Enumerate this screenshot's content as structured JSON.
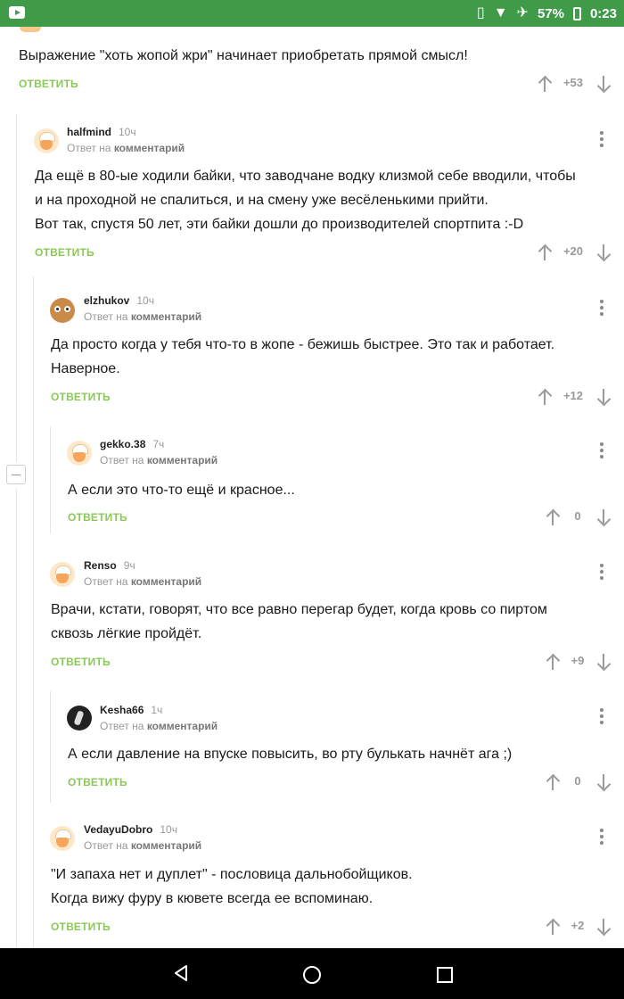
{
  "status_bar": {
    "app_icon": "youtube-icon",
    "icons": [
      "vibrate-icon",
      "wifi-icon",
      "airplane-icon"
    ],
    "battery": "57%",
    "time": "0:23"
  },
  "labels": {
    "reply_button": "ОТВЕТИТЬ",
    "reply_to_prefix": "Ответ на",
    "reply_to_target": "комментарий"
  },
  "top_comment": {
    "text": "Выражение \"хоть жопой жри\" начинает приобретать прямой смысл!",
    "score": "+53"
  },
  "comments": [
    {
      "author": "halfmind",
      "time": "10ч",
      "avatar": "cook",
      "lines": [
        "Да ещё в 80-ые ходили байки, что заводчане водку клизмой себе вводили, чтобы",
        "и на проходной не спалиться, и на смену уже весёленькими прийти.",
        "Вот так, спустя 50 лет, эти байки дошли до производителей спортпита :-D"
      ],
      "score": "+20"
    },
    {
      "author": "elzhukov",
      "time": "10ч",
      "avatar": "owl",
      "lines": [
        "Да просто когда у тебя что-то в жопе - бежишь быстрее. Это так и работает.",
        "Наверное."
      ],
      "score": "+12"
    },
    {
      "author": "gekko.38",
      "time": "7ч",
      "avatar": "cook",
      "lines": [
        "А если это что-то ещё и красное..."
      ],
      "score": "0"
    },
    {
      "author": "Renso",
      "time": "9ч",
      "avatar": "cook",
      "lines": [
        "Врачи, кстати, говорят, что все равно перегар будет, когда кровь со пиртом",
        "сквозь лёгкие пройдёт."
      ],
      "score": "+9"
    },
    {
      "author": "Kesha66",
      "time": "1ч",
      "avatar": "dark",
      "lines": [
        "А если давление на впуске повысить, во рту булькать начнёт ага ;)"
      ],
      "score": "0"
    },
    {
      "author": "VedayuDobro",
      "time": "10ч",
      "avatar": "cook",
      "lines": [
        "\"И запаха нет и дуплет\" - пословица дальнобойщиков.",
        "Когда вижу фуру в кювете всегда ее вспоминаю."
      ],
      "score": "+2"
    }
  ],
  "nav": {
    "back": "back-icon",
    "home": "home-icon",
    "recents": "recents-icon"
  }
}
